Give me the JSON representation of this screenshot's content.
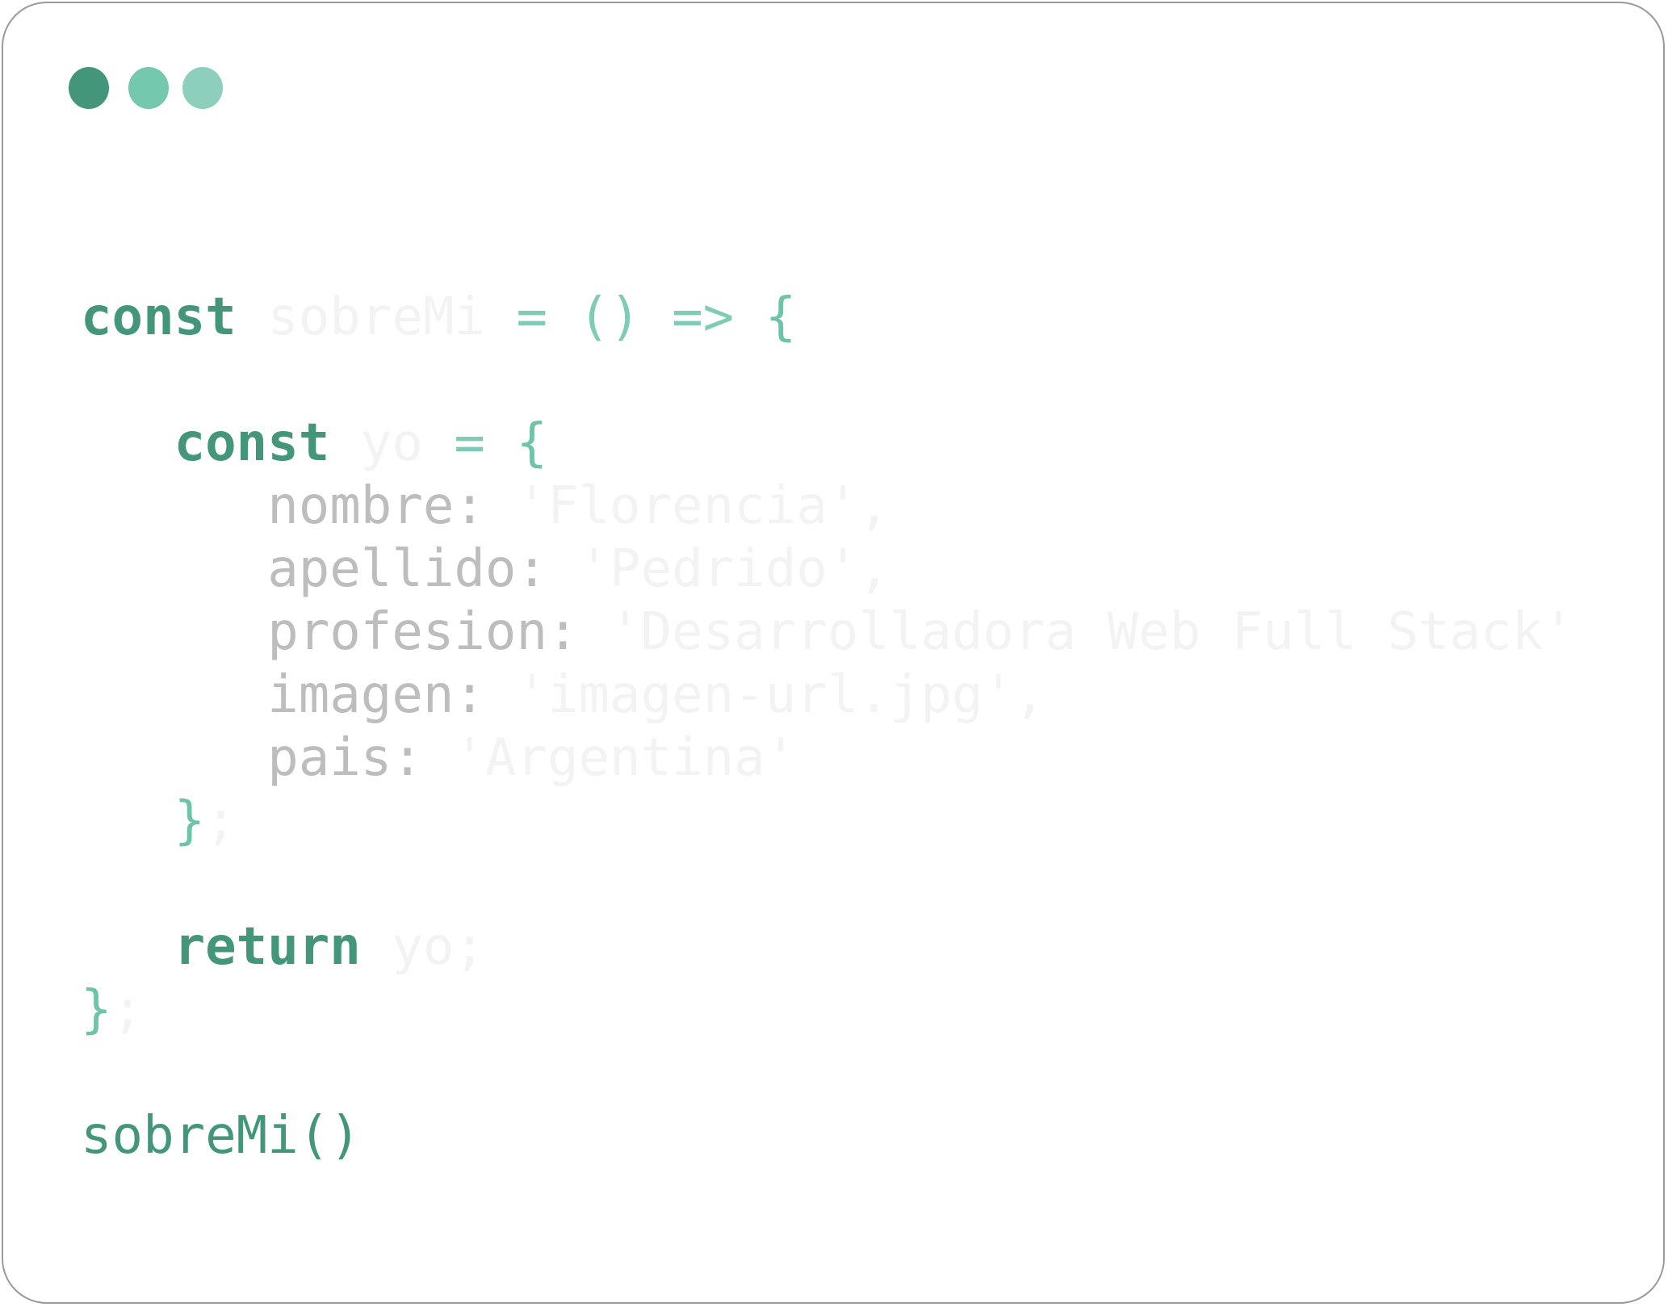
{
  "colors": {
    "keyword": "#44967a",
    "operator_light": "#7ecbb6",
    "brace": "#6dc4a9",
    "dot_1": "#44967a",
    "dot_2": "#74c8ae",
    "dot_3": "#8ccfbc",
    "text_gray": "#bdbdbd",
    "text_faint": "#f3f3f3",
    "border": "#9a9a9a"
  },
  "window_controls": [
    {
      "name": "dot-1",
      "color": "#44967a"
    },
    {
      "name": "dot-2",
      "color": "#74c8ae"
    },
    {
      "name": "dot-3",
      "color": "#8ccfbc"
    }
  ],
  "code": {
    "line1": {
      "kw": "const",
      "name": "sobreMi",
      "assign": "=",
      "parens": "()",
      "arrow": "=>",
      "open": "{"
    },
    "line2": {
      "kw": "const",
      "name": "yo",
      "assign": "=",
      "open": "{"
    },
    "props": [
      {
        "key": "nombre:",
        "value": "'Florencia',"
      },
      {
        "key": "apellido:",
        "value": "'Pedrido',"
      },
      {
        "key": "profesion:",
        "value": "'Desarrolladora Web Full Stack'"
      },
      {
        "key": "imagen:",
        "value": "'imagen-url.jpg',"
      },
      {
        "key": "pais:",
        "value": "'Argentina'"
      }
    ],
    "close_obj": {
      "brace": "}",
      "rest": ";"
    },
    "return_line": {
      "kw": "return",
      "value": "yo;"
    },
    "close_fn": {
      "brace": "}",
      "rest": ";"
    },
    "call": "sobreMi()"
  }
}
